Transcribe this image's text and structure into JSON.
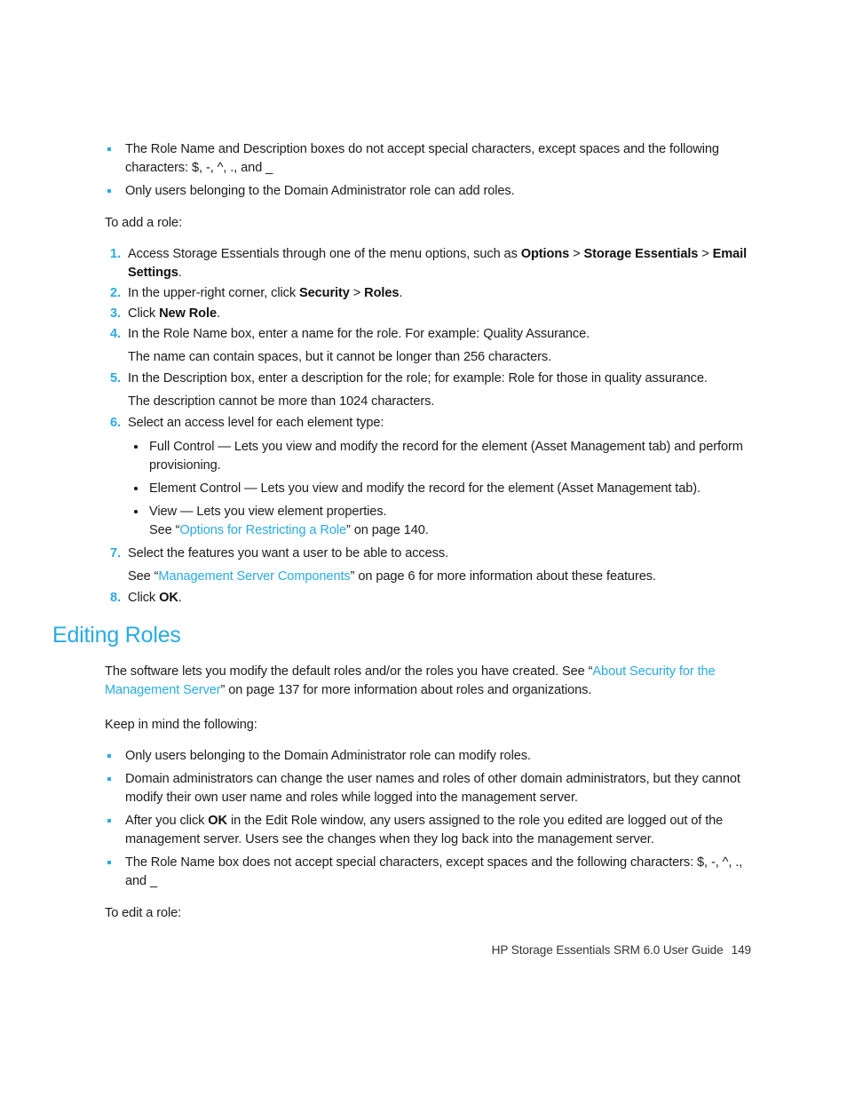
{
  "colors": {
    "accent": "#29ABE2",
    "text": "#1b1b1b",
    "background": "#ffffff"
  },
  "intro_bullets": [
    {
      "parts": [
        {
          "t": "The Role Name and Description boxes do not accept special characters, except spaces and the following characters: $, -, ^, ., and _"
        }
      ]
    },
    {
      "parts": [
        {
          "t": "Only users belonging to the Domain Administrator role can add roles."
        }
      ]
    }
  ],
  "add_role_lead": "To add a role:",
  "add_role_steps": [
    {
      "num": "1.",
      "parts": [
        {
          "t": "Access Storage Essentials through one of the menu options, such as "
        },
        {
          "t": "Options",
          "style": "bold"
        },
        {
          "t": " > "
        },
        {
          "t": "Storage Essentials",
          "style": "bold"
        },
        {
          "t": " > "
        },
        {
          "t": "Email Settings",
          "style": "bold"
        },
        {
          "t": "."
        }
      ]
    },
    {
      "num": "2.",
      "parts": [
        {
          "t": "In the upper-right corner, click "
        },
        {
          "t": "Security",
          "style": "bold"
        },
        {
          "t": " > "
        },
        {
          "t": "Roles",
          "style": "bold"
        },
        {
          "t": "."
        }
      ]
    },
    {
      "num": "3.",
      "parts": [
        {
          "t": "Click "
        },
        {
          "t": "New Role",
          "style": "bold"
        },
        {
          "t": "."
        }
      ]
    },
    {
      "num": "4.",
      "parts": [
        {
          "t": "In the Role Name box, enter a name for the role. For example: Quality Assurance."
        }
      ],
      "note": "The name can contain spaces, but it cannot be longer than 256 characters."
    },
    {
      "num": "5.",
      "parts": [
        {
          "t": "In the Description box, enter a description for the role; for example: Role for those in quality assurance."
        }
      ],
      "note": "The description cannot be more than 1024 characters."
    },
    {
      "num": "6.",
      "parts": [
        {
          "t": "Select an access level for each element type:"
        }
      ],
      "nested": [
        {
          "parts": [
            {
              "t": "Full Control — Lets you view and modify the record for the element (Asset Management tab) and perform provisioning."
            }
          ]
        },
        {
          "parts": [
            {
              "t": "Element Control — Lets you view and modify the record for the element (Asset Management tab)."
            }
          ]
        },
        {
          "parts": [
            {
              "t": "View — Lets you view element properties."
            },
            {
              "t": "\n",
              "style": "break"
            },
            {
              "t": "See “"
            },
            {
              "t": "Options for Restricting a Role",
              "style": "link"
            },
            {
              "t": "” on page 140."
            }
          ]
        }
      ]
    },
    {
      "num": "7.",
      "parts": [
        {
          "t": "Select the features you want a user to be able to access."
        }
      ],
      "note_parts": [
        {
          "t": "See “"
        },
        {
          "t": "Management Server Components",
          "style": "link"
        },
        {
          "t": "” on page 6 for more information about these features."
        }
      ]
    },
    {
      "num": "8.",
      "parts": [
        {
          "t": "Click "
        },
        {
          "t": "OK",
          "style": "bold"
        },
        {
          "t": "."
        }
      ]
    }
  ],
  "section": {
    "heading": "Editing Roles",
    "intro_parts": [
      {
        "t": "The software lets you modify the default roles and/or the roles you have created. See “"
      },
      {
        "t": "About Security for the Management Server",
        "style": "link"
      },
      {
        "t": "” on page 137 for more information about roles and organizations."
      }
    ],
    "keep_in_mind_lead": "Keep in mind the following:",
    "keep_in_mind_bullets": [
      {
        "parts": [
          {
            "t": "Only users belonging to the Domain Administrator role can modify roles."
          }
        ]
      },
      {
        "parts": [
          {
            "t": "Domain administrators can change the user names and roles of other domain administrators, but they cannot modify their own user name and roles while logged into the management server."
          }
        ]
      },
      {
        "parts": [
          {
            "t": "After you click "
          },
          {
            "t": "OK",
            "style": "bold"
          },
          {
            "t": " in the Edit Role window, any users assigned to the role you edited are logged out of the management server. Users see the changes when they log back into the management server."
          }
        ]
      },
      {
        "parts": [
          {
            "t": "The Role Name box does not accept special characters, except spaces and the following characters: $, -, ^, ., and _"
          }
        ]
      }
    ],
    "edit_role_lead": "To edit a role:"
  },
  "footer": {
    "guide_title": "HP Storage Essentials SRM 6.0 User Guide",
    "page_number": "149"
  }
}
